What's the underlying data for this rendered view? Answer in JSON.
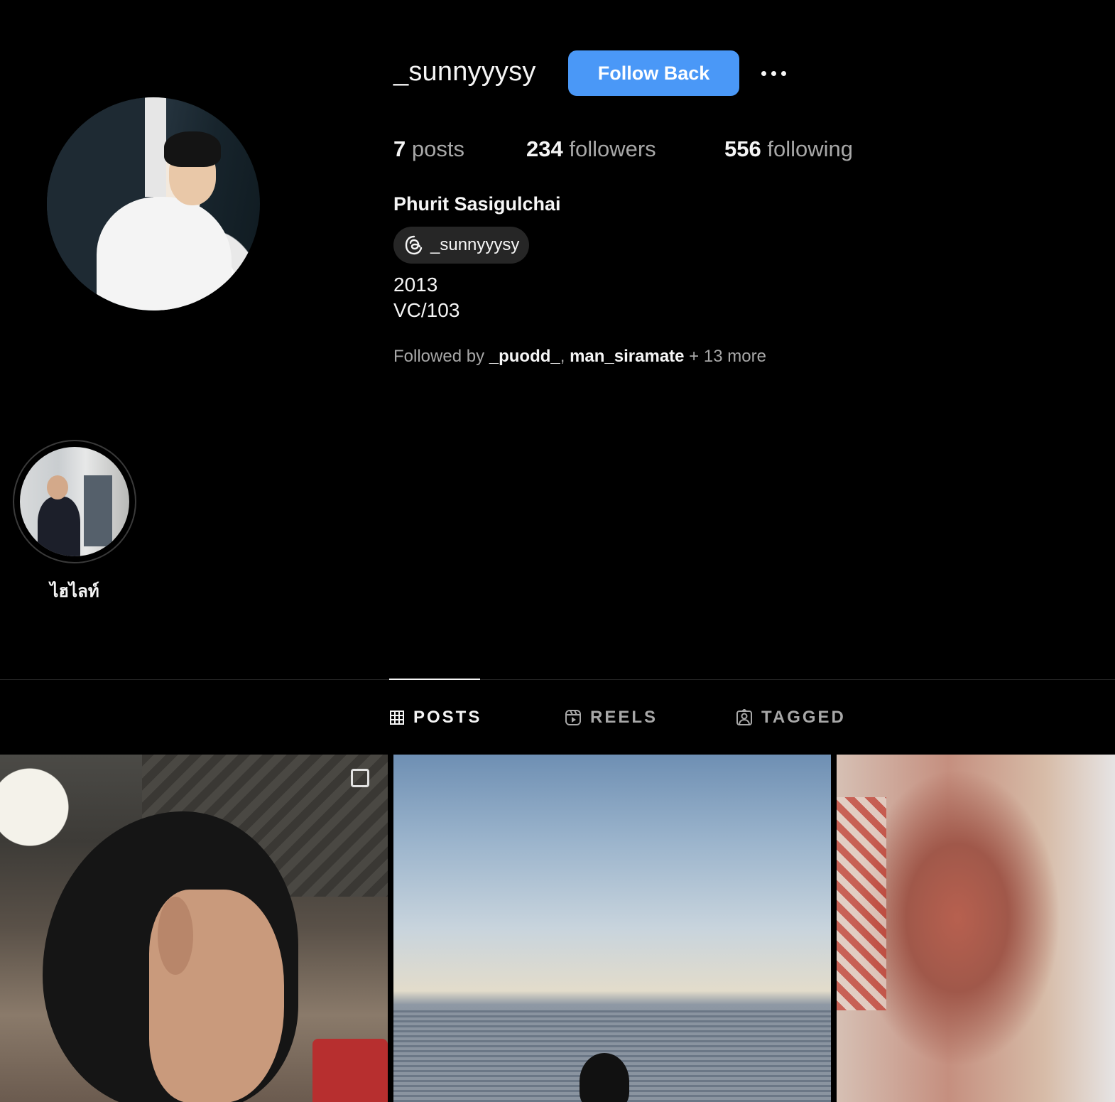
{
  "profile": {
    "username": "_sunnyyysy",
    "follow_label": "Follow Back",
    "more_label": "",
    "stats": {
      "posts_count": "7",
      "posts_label": " posts",
      "followers_count": "234",
      "followers_label": " followers",
      "following_count": "556",
      "following_label": " following"
    },
    "full_name": "Phurit Sasigulchai",
    "threads_handle": "_sunnyyysy",
    "bio_line_1": "2013",
    "bio_line_2": "VC/103",
    "followed_by": {
      "prefix": "Followed by ",
      "user_1": "_puodd_",
      "sep": ", ",
      "user_2": "man_siramate",
      "suffix": " + 13 more"
    }
  },
  "highlights": [
    {
      "label": "ไฮไลท์"
    }
  ],
  "tabs": [
    {
      "label": "POSTS",
      "active": true
    },
    {
      "label": "REELS",
      "active": false
    },
    {
      "label": "TAGGED",
      "active": false
    }
  ],
  "colors": {
    "background": "#000000",
    "accent_button": "#4a98f7",
    "muted_text": "#a8a8a8",
    "primary_text": "#f5f5f5",
    "badge_bg": "#262626"
  },
  "icons": {
    "threads": "threads-icon",
    "more": "more-horizontal-icon",
    "posts_tab": "grid-icon",
    "reels_tab": "reels-icon",
    "tagged_tab": "tagged-user-icon",
    "multi_post": "multi-image-icon"
  }
}
